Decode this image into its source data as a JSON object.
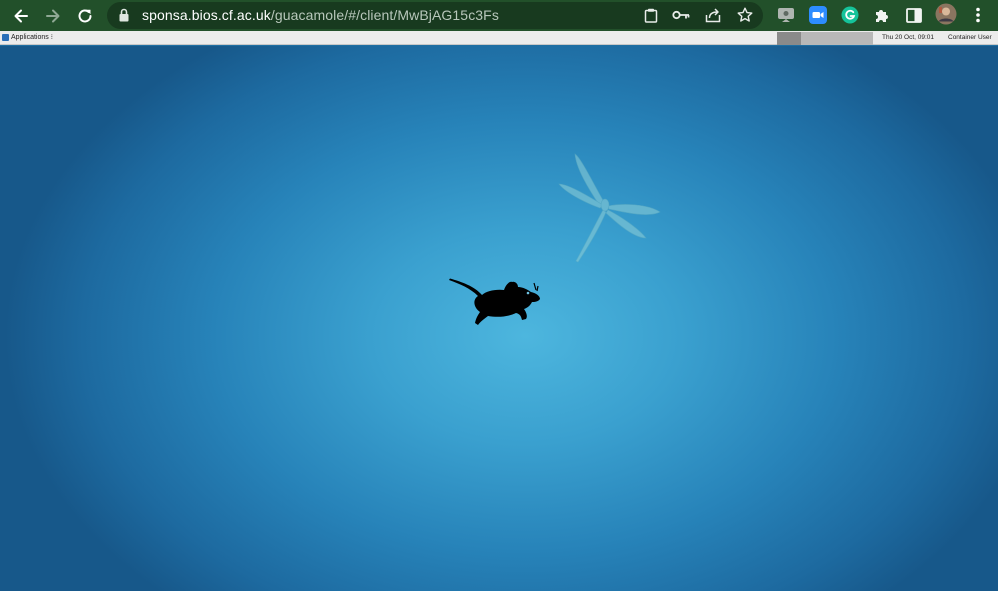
{
  "browser": {
    "url_host": "sponsa.bios.cf.ac.uk",
    "url_path": "/guacamole/#/client/MwBjAG15c3Fs",
    "nav": {
      "back_icon": "arrow-left-icon",
      "forward_icon": "arrow-right-icon",
      "reload_icon": "reload-icon"
    },
    "omnibox_icons": [
      "clipboard-icon",
      "key-icon",
      "share-icon",
      "star-icon"
    ],
    "extension_icons": [
      "screencast-extension-icon",
      "zoom-extension-icon",
      "grammarly-extension-icon",
      "puzzle-extensions-icon",
      "side-panel-icon",
      "profile-avatar-icon",
      "kebab-menu-icon"
    ],
    "colors": {
      "frame": "#22502a",
      "omnibox": "#183a1f",
      "zoom": "#2d8cff",
      "grammarly": "#15c39a"
    }
  },
  "remote_panel": {
    "applications_label": "Applications ⁝",
    "clock": "Thu 20 Oct, 09:01",
    "user": "Container User"
  },
  "desktop": {
    "wallpaper": "xfce-blue-dragonfly",
    "logo_icon": "xfce-mouse-icon"
  }
}
